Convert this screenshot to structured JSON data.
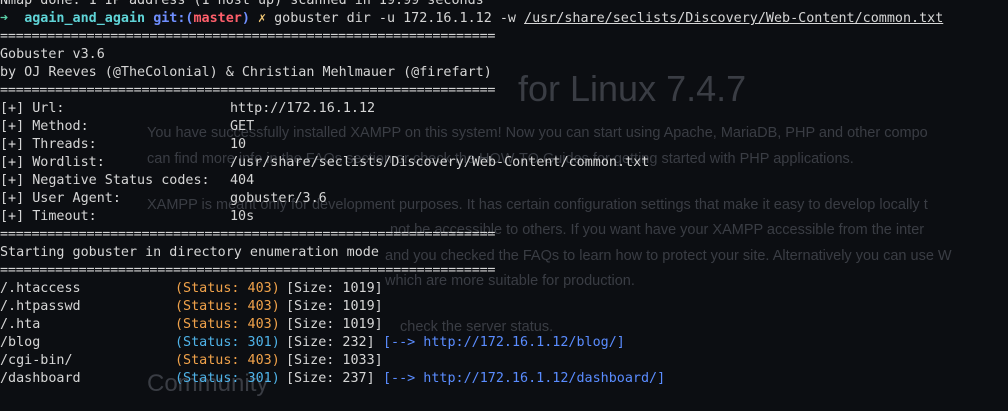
{
  "background_page": {
    "heading": "for Linux 7.4.7",
    "lines": [
      "You have successfully installed XAMPP on this system! Now you can start using Apache, MariaDB, PHP and other compo",
      "can find more info in the FAQs section or check the HOW-TO Guides for getting started with PHP applications.",
      "XAMPP is meant only for development purposes. It has certain configuration settings that make it easy to develop locally t",
      "not be accessible to others. If you want have your XAMPP accessible from the inter",
      "and you checked the FAQs to learn how to protect your site. Alternatively you can use W",
      "which are more suitable for production.",
      "check the server status."
    ],
    "subheading": "Community"
  },
  "terminal": {
    "nmap_line": "Nmap done: 1 IP address (1 host up) scanned in 19.99 seconds",
    "prompt": {
      "arrow": "➜",
      "dir": "again_and_again",
      "git_label": "git:(",
      "branch": "master",
      "git_close": ")",
      "dirty": "✗",
      "command": "gobuster dir -u 172.16.1.12 -w ",
      "wordlist_arg": "/usr/share/seclists/Discovery/Web-Content/common.txt"
    },
    "separator": "===============================================================",
    "banner_title": "Gobuster v3.6",
    "banner_author": "by OJ Reeves (@TheColonial) & Christian Mehlmauer (@firefart)",
    "config": [
      {
        "key": "[+] Url:",
        "value": "http://172.16.1.12"
      },
      {
        "key": "[+] Method:",
        "value": "GET"
      },
      {
        "key": "[+] Threads:",
        "value": "10"
      },
      {
        "key": "[+] Wordlist:",
        "value": "/usr/share/seclists/Discovery/Web-Content/common.txt"
      },
      {
        "key": "[+] Negative Status codes:",
        "value": "404"
      },
      {
        "key": "[+] User Agent:",
        "value": "gobuster/3.6"
      },
      {
        "key": "[+] Timeout:",
        "value": "10s"
      }
    ],
    "start_message": "Starting gobuster in directory enumeration mode",
    "results": [
      {
        "path": "/.htaccess",
        "status": "(Status: 403)",
        "code": "403",
        "size": "[Size: 1019]",
        "redirect": ""
      },
      {
        "path": "/.htpasswd",
        "status": "(Status: 403)",
        "code": "403",
        "size": "[Size: 1019]",
        "redirect": ""
      },
      {
        "path": "/.hta",
        "status": "(Status: 403)",
        "code": "403",
        "size": "[Size: 1019]",
        "redirect": ""
      },
      {
        "path": "/blog",
        "status": "(Status: 301)",
        "code": "301",
        "size": "[Size: 232]",
        "redirect": "[--> http://172.16.1.12/blog/]"
      },
      {
        "path": "/cgi-bin/",
        "status": "(Status: 403)",
        "code": "403",
        "size": "[Size: 1033]",
        "redirect": ""
      },
      {
        "path": "/dashboard",
        "status": "(Status: 301)",
        "code": "301",
        "size": "[Size: 237]",
        "redirect": "[--> http://172.16.1.12/dashboard/]"
      }
    ]
  },
  "colors": {
    "background": "#0c0e12",
    "text": "#d6d6d6",
    "status_403": "#f0a24a",
    "status_301": "#4fb3e8",
    "redirect": "#5a8cff",
    "branch": "#ff5f6b"
  }
}
